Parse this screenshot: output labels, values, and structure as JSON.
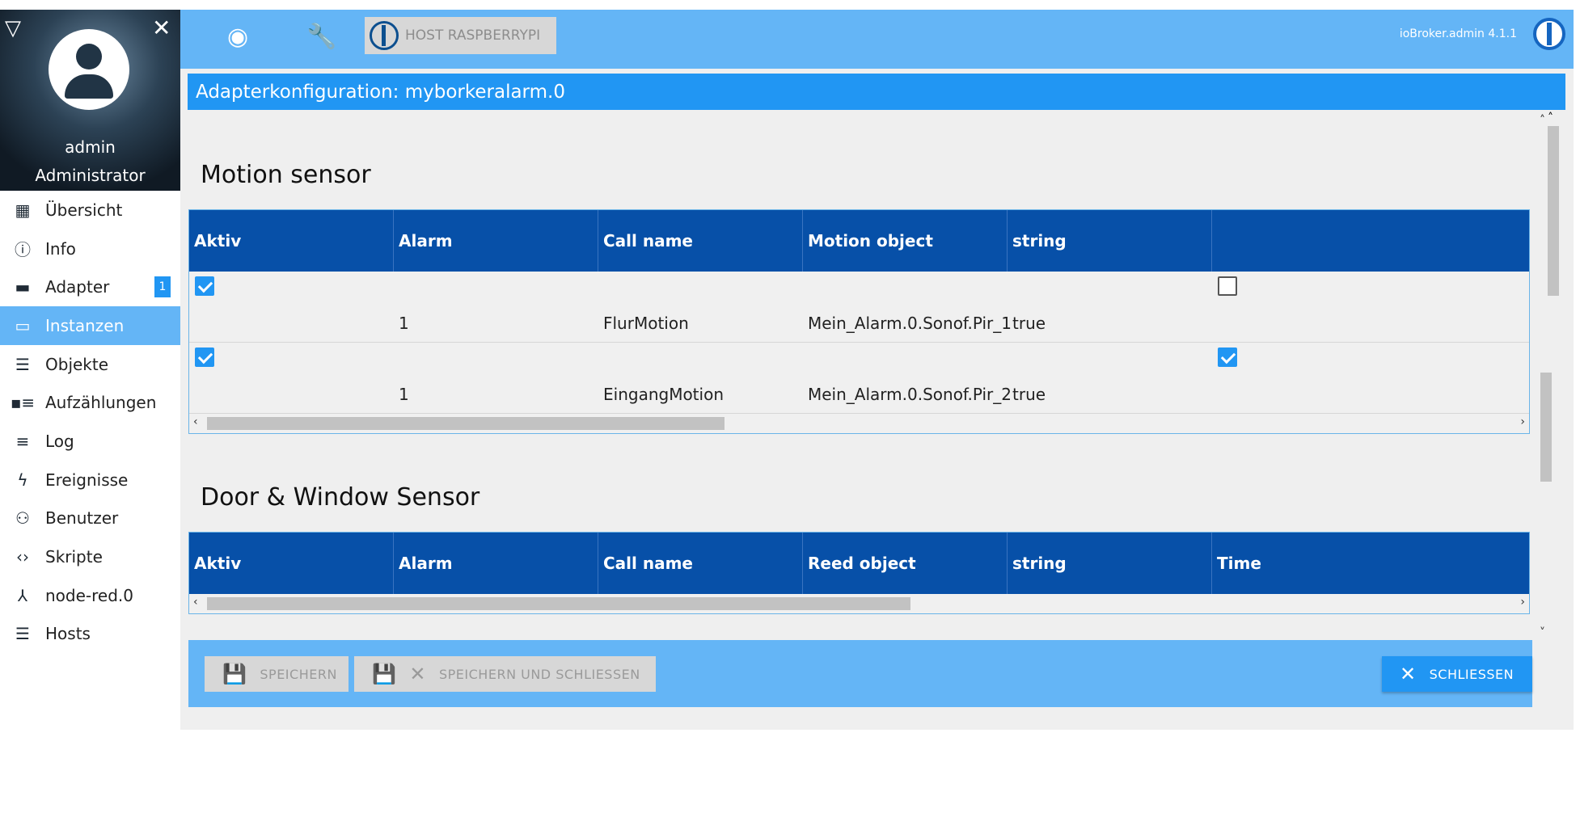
{
  "sidebar": {
    "user_name": "admin",
    "user_role": "Administrator",
    "items": [
      {
        "label": "Übersicht",
        "icon": "grid-icon"
      },
      {
        "label": "Info",
        "icon": "info-icon"
      },
      {
        "label": "Adapter",
        "icon": "store-icon",
        "badge": "1"
      },
      {
        "label": "Instanzen",
        "icon": "instances-icon",
        "active": true
      },
      {
        "label": "Objekte",
        "icon": "list-icon"
      },
      {
        "label": "Aufzählungen",
        "icon": "enum-icon"
      },
      {
        "label": "Log",
        "icon": "log-icon"
      },
      {
        "label": "Ereignisse",
        "icon": "lightning-icon"
      },
      {
        "label": "Benutzer",
        "icon": "user-icon"
      },
      {
        "label": "Skripte",
        "icon": "code-icon"
      },
      {
        "label": "node-red.0",
        "icon": "node-red-icon"
      },
      {
        "label": "Hosts",
        "icon": "hosts-icon"
      }
    ]
  },
  "topbar": {
    "host_label": "HOST RASPBERRYPI",
    "app_version": "ioBroker.admin 4.1.1"
  },
  "config": {
    "title": "Adapterkonfiguration: myborkeralarm.0"
  },
  "motion": {
    "title": "Motion sensor",
    "headers": [
      "Aktiv",
      "Alarm",
      "Call name",
      "Motion object",
      "string",
      ""
    ],
    "rows": [
      {
        "aktiv": true,
        "alarm": "1",
        "call_name": "FlurMotion",
        "object": "Mein_Alarm.0.Sonof.Pir_1",
        "string": "true",
        "extra": false
      },
      {
        "aktiv": true,
        "alarm": "1",
        "call_name": "EingangMotion",
        "object": "Mein_Alarm.0.Sonof.Pir_2",
        "string": "true",
        "extra": true
      }
    ]
  },
  "door": {
    "title": "Door & Window Sensor",
    "headers": [
      "Aktiv",
      "Alarm",
      "Call name",
      "Reed object",
      "string",
      "Time"
    ]
  },
  "footer": {
    "save_label": "SPEICHERN",
    "save_close_label": "SPEICHERN UND SCHLIESSEN",
    "close_label": "SCHLIESSEN"
  },
  "colors": {
    "topbar": "#64b5f6",
    "table_header": "#0750a8",
    "accent": "#2196f3"
  }
}
